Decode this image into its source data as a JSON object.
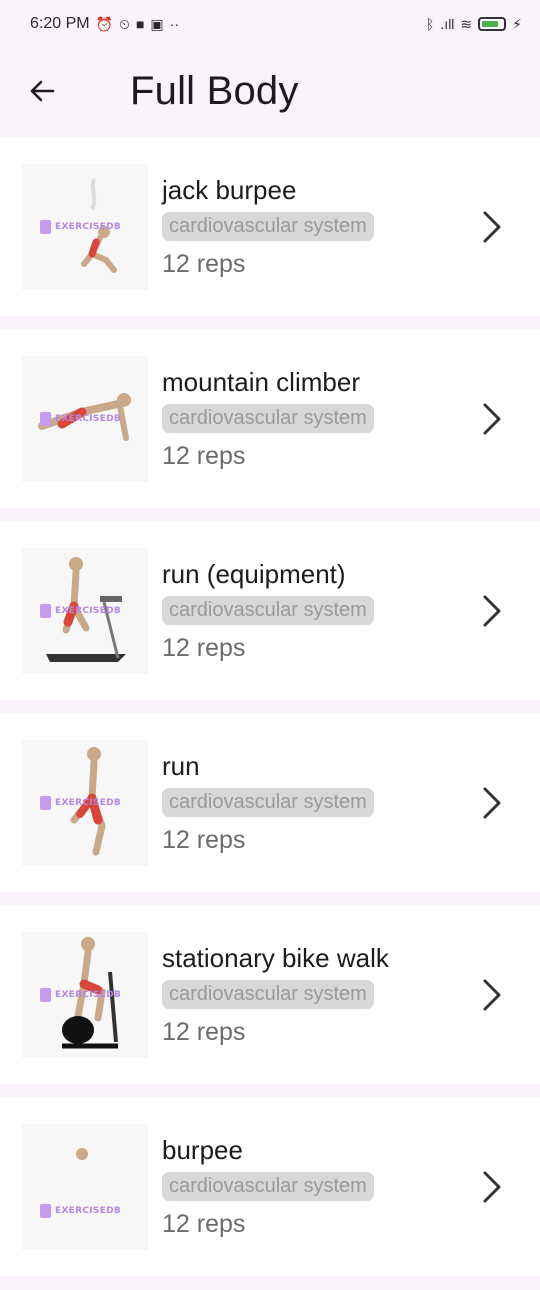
{
  "status_bar": {
    "time": "6:20 PM",
    "icons_left": [
      "alarm-off-icon",
      "alarm-icon",
      "video-icon",
      "calendar-icon",
      "more-dots-icon"
    ],
    "icons_right": [
      "bluetooth-icon",
      "signal-icon",
      "wifi-icon",
      "battery-icon",
      "charging-icon"
    ]
  },
  "app_bar": {
    "title": "Full Body",
    "back_icon": "arrow-left-icon"
  },
  "exercises": [
    {
      "name": "jack burpee",
      "category": "cardiovascular system",
      "reps": "12 reps"
    },
    {
      "name": "mountain climber",
      "category": "cardiovascular system",
      "reps": "12 reps"
    },
    {
      "name": "run (equipment)",
      "category": "cardiovascular system",
      "reps": "12 reps"
    },
    {
      "name": "run",
      "category": "cardiovascular system",
      "reps": "12 reps"
    },
    {
      "name": "stationary bike walk",
      "category": "cardiovascular system",
      "reps": "12 reps"
    },
    {
      "name": "burpee",
      "category": "cardiovascular system",
      "reps": "12 reps"
    }
  ],
  "watermark_text": "EXERCISEDB",
  "colors": {
    "background": "#fbf3fb",
    "card": "#ffffff",
    "chip": "#d8d8d8",
    "watermark": "#b487e0"
  }
}
